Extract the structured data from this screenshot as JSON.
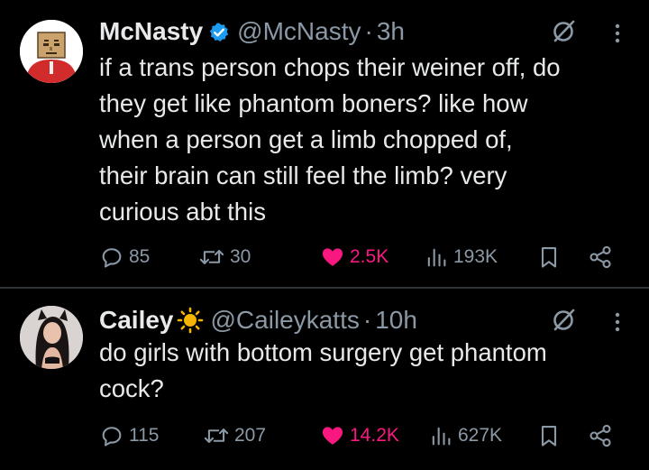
{
  "colors": {
    "background": "#000000",
    "text": "#e7e9ea",
    "muted": "#8b98a5",
    "like": "#f91880",
    "verified": "#1d9bf0",
    "divider": "#2f3336"
  },
  "tweets": [
    {
      "name": "McNasty",
      "badge_icon": "verified-badge-icon",
      "handle": "@McNasty",
      "dot": "·",
      "time": "3h",
      "text_lines": [
        "if a trans person chops their weiner off, do",
        "they get like phantom boners? like how",
        "when a person get a limb chopped of,",
        "their brain can still feel the limb? very",
        "curious abt this"
      ],
      "replies": "85",
      "reposts": "30",
      "likes": "2.5K",
      "views": "193K"
    },
    {
      "name": "Cailey",
      "badge_icon": "sun-icon",
      "handle": "@Caileykatts",
      "dot": "·",
      "time": "10h",
      "text_lines": [
        "do girls with bottom surgery get phantom",
        "cock?"
      ],
      "replies": "115",
      "reposts": "207",
      "likes": "14.2K",
      "views": "627K"
    }
  ]
}
